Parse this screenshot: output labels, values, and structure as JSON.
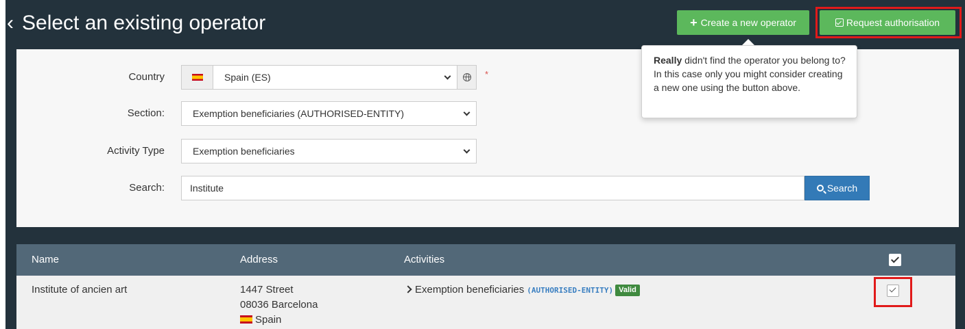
{
  "header": {
    "back_icon": "chevron-left-icon",
    "title": "Select an existing operator",
    "create_button": {
      "icon": "plus-icon",
      "label": "Create a new operator"
    },
    "request_button": {
      "icon": "check-square-icon",
      "label": "Request authorisation"
    }
  },
  "tooltip": {
    "bold": "Really",
    "text": " didn't find the operator you belong to? In this case only you might consider creating a new one using the button above."
  },
  "form": {
    "country": {
      "label": "Country",
      "value": "Spain (ES)",
      "flag": "flag-es-icon",
      "required": "*"
    },
    "section": {
      "label": "Section:",
      "value": "Exemption beneficiaries (AUTHORISED-ENTITY)"
    },
    "activity_type": {
      "label": "Activity Type",
      "value": "Exemption beneficiaries"
    },
    "search": {
      "label": "Search:",
      "value": "Institute",
      "button_label": "Search"
    }
  },
  "table": {
    "columns": [
      "Name",
      "Address",
      "Activities"
    ],
    "rows": [
      {
        "name": "Institute of ancien art",
        "address_line1": "1447 Street",
        "address_line2": "08036 Barcelona",
        "country": "Spain",
        "activity": "Exemption beneficiaries",
        "activity_code": "(AUTHORISED-ENTITY)",
        "status": "Valid",
        "checked": true
      }
    ]
  },
  "colors": {
    "header_bg": "#23323c",
    "green": "#5cb85c",
    "blue": "#337ab7",
    "table_head": "#526878",
    "highlight": "#e11a1a"
  }
}
